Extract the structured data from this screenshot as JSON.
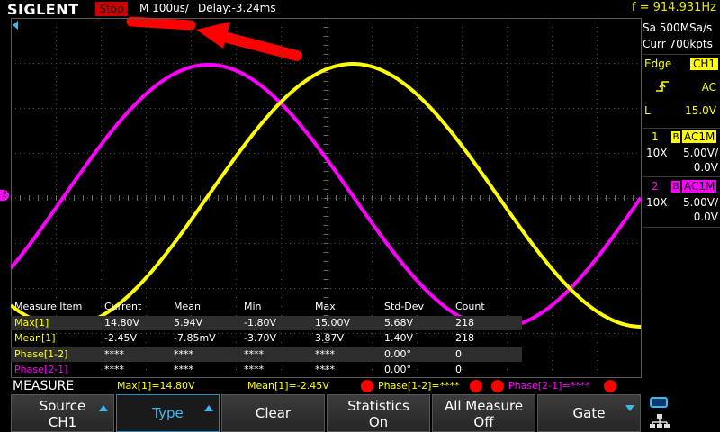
{
  "header": {
    "brand": "SIGLENT",
    "run_state": "Stop",
    "timebase": "M 100us/",
    "delay": "Delay:-3.24ms",
    "frequency": "f = 914.931Hz"
  },
  "acquisition": {
    "sample_rate": "Sa 500MSa/s",
    "memory": "Curr 700kpts"
  },
  "trigger": {
    "mode": "Edge",
    "source": "CH1",
    "coupling": "AC",
    "level_label": "L",
    "level": "15.0V"
  },
  "channels": [
    {
      "number": "1",
      "bw": "B",
      "coupling": "AC1M",
      "probe": "10X",
      "scale": "5.00V/",
      "offset": "0.0V",
      "color": "#ffff00"
    },
    {
      "number": "2",
      "bw": "B",
      "coupling": "AC1M",
      "probe": "10X",
      "scale": "5.00V/",
      "offset": "0.0V",
      "color": "#ff00ff"
    }
  ],
  "measure_table": {
    "headers": [
      "Measure Item",
      "Current",
      "Mean",
      "Min",
      "Max",
      "Std-Dev",
      "Count"
    ],
    "rows": [
      {
        "item": "Max[1]",
        "current": "14.80V",
        "mean": "5.94V",
        "min": "-1.80V",
        "max": "15.00V",
        "std": "5.68V",
        "count": "218",
        "color": "#ffff00"
      },
      {
        "item": "Mean[1]",
        "current": "-2.45V",
        "mean": "-7.85mV",
        "min": "-3.70V",
        "max": "3.87V",
        "std": "1.40V",
        "count": "218",
        "color": "#ffff00"
      },
      {
        "item": "Phase[1-2]",
        "current": "****",
        "mean": "****",
        "min": "****",
        "max": "****",
        "std": "0.00°",
        "count": "0",
        "color": "#ffff00"
      },
      {
        "item": "Phase[2-1]",
        "current": "****",
        "mean": "****",
        "min": "****",
        "max": "****",
        "std": "0.00°",
        "count": "0",
        "color": "#ff00ff"
      }
    ]
  },
  "measure_bar": {
    "title": "MEASURE",
    "items": [
      "Max[1]=14.80V",
      "Mean[1]=-2.45V",
      "Phase[1-2]=****",
      "Phase[2-1]=****"
    ]
  },
  "softkeys": {
    "source_l1": "Source",
    "source_l2": "CH1",
    "type": "Type",
    "clear": "Clear",
    "stats_l1": "Statistics",
    "stats_l2": "On",
    "allm_l1": "All Measure",
    "allm_l2": "Off",
    "gate": "Gate"
  },
  "colors": {
    "ch1": "#ffff00",
    "ch2": "#ff00ff",
    "accent": "#3fb8f0",
    "stop": "#d00000"
  }
}
